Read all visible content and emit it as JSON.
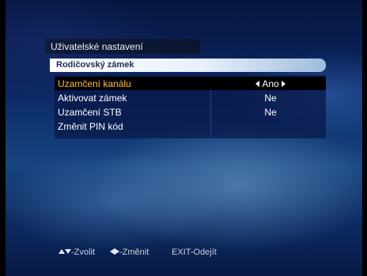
{
  "window": {
    "title": "Uživatelské nastavení"
  },
  "section": {
    "title": "Rodičovský zámek"
  },
  "settings": [
    {
      "label": "Uzamčení kanálu",
      "value": "Ano",
      "selected": true
    },
    {
      "label": "Aktivovat zámek",
      "value": "Ne",
      "selected": false
    },
    {
      "label": "Uzamčení STB",
      "value": "Ne",
      "selected": false
    },
    {
      "label": "Změnit PIN kód",
      "value": "",
      "selected": false
    }
  ],
  "footer": {
    "navigate_label": "-Zvolit",
    "change_label": "-Změnit",
    "exit_label": "EXIT-Odejít"
  },
  "colors": {
    "highlight_text": "#ffc01a",
    "header_bg": "#e8f0fb",
    "panel_bg": "#08184a"
  }
}
